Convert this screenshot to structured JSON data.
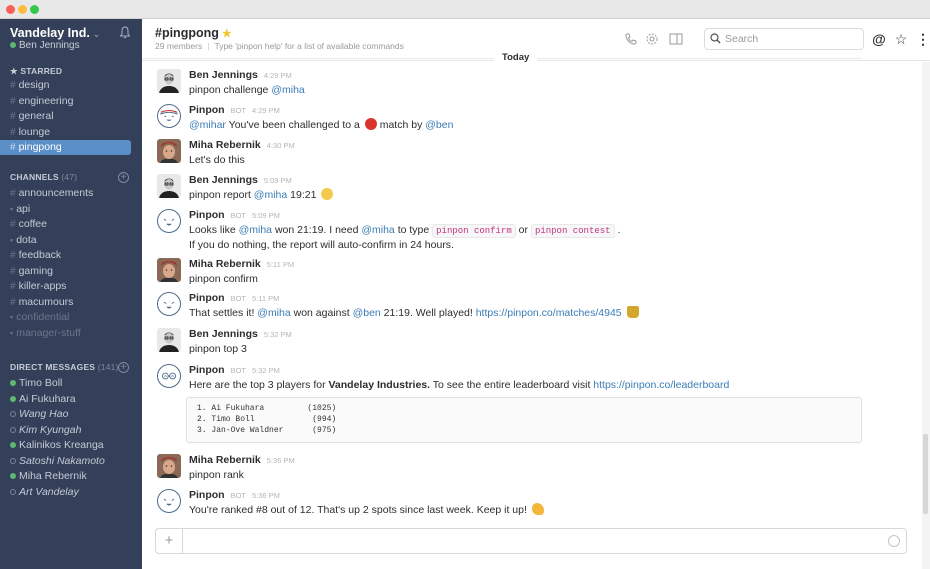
{
  "window": {
    "buttons": [
      "close",
      "minimize",
      "maximize"
    ]
  },
  "sidebar": {
    "team_name": "Vandelay Ind.",
    "current_user": "Ben Jennings",
    "starred_label": "STARRED",
    "starred": [
      {
        "name": "design",
        "prefix": "#"
      },
      {
        "name": "engineering",
        "prefix": "#"
      },
      {
        "name": "general",
        "prefix": "#"
      },
      {
        "name": "lounge",
        "prefix": "#"
      },
      {
        "name": "pingpong",
        "prefix": "#",
        "active": true
      }
    ],
    "channels_label": "CHANNELS",
    "channels_count": "(47)",
    "channels": [
      {
        "name": "announcements",
        "prefix": "#"
      },
      {
        "name": "api",
        "prefix": "lock"
      },
      {
        "name": "coffee",
        "prefix": "#"
      },
      {
        "name": "dota",
        "prefix": "lock"
      },
      {
        "name": "feedback",
        "prefix": "#"
      },
      {
        "name": "gaming",
        "prefix": "#"
      },
      {
        "name": "killer-apps",
        "prefix": "#"
      },
      {
        "name": "macumours",
        "prefix": "#"
      },
      {
        "name": "confidential",
        "prefix": "lock",
        "muted": true
      },
      {
        "name": "manager-stuff",
        "prefix": "lock",
        "muted": true
      }
    ],
    "dm_label": "DIRECT MESSAGES",
    "dm_count": "(141)",
    "dms": [
      {
        "name": "Timo Boll",
        "online": true
      },
      {
        "name": "Ai Fukuhara",
        "online": true
      },
      {
        "name": "Wang Hao",
        "online": false
      },
      {
        "name": "Kim Kyungah",
        "online": false
      },
      {
        "name": "Kalinikos Kreanga",
        "online": true
      },
      {
        "name": "Satoshi Nakamoto",
        "online": false
      },
      {
        "name": "Miha Rebernik",
        "online": true
      },
      {
        "name": "Art Vandelay",
        "online": false
      }
    ]
  },
  "header": {
    "channel": "#pingpong",
    "members": "29 members",
    "topic": "Type 'pinpon help' for a list of available commands",
    "search_placeholder": "Search",
    "icons": [
      "phone-icon",
      "gear-icon",
      "sidebar-toggle-icon",
      "mention-icon",
      "star-icon",
      "more-icon"
    ]
  },
  "divider_label": "Today",
  "messages": [
    {
      "author": "Ben Jennings",
      "time": "4:29 PM",
      "bot": false,
      "avatar": "ben",
      "parts": [
        {
          "t": "pinpon challenge "
        },
        {
          "m": "@miha"
        }
      ]
    },
    {
      "author": "Pinpon",
      "time": "4:29 PM",
      "bot": true,
      "avatar": "bot-headband",
      "parts": [
        {
          "m": "@mihar"
        },
        {
          "t": " You've been challenged to a "
        },
        {
          "e": "ping-pong-paddle"
        },
        {
          "t": " match by "
        },
        {
          "m": "@ben"
        }
      ]
    },
    {
      "author": "Miha Rebernik",
      "time": "4:30 PM",
      "bot": false,
      "avatar": "miha",
      "parts": [
        {
          "t": "Let's do this"
        }
      ]
    },
    {
      "author": "Ben Jennings",
      "time": "5:09 PM",
      "bot": false,
      "avatar": "ben",
      "parts": [
        {
          "t": "pinpon report "
        },
        {
          "m": "@miha"
        },
        {
          "t": " 19:21 "
        },
        {
          "e": "sweat-face"
        }
      ]
    },
    {
      "author": "Pinpon",
      "time": "5:09 PM",
      "bot": true,
      "avatar": "bot-happy",
      "parts": [
        {
          "t": "Looks like "
        },
        {
          "m": "@miha"
        },
        {
          "t": " won 21:19. I need "
        },
        {
          "m": "@miha"
        },
        {
          "t": " to type "
        },
        {
          "c": "pinpon confirm"
        },
        {
          "t": " or "
        },
        {
          "c": "pinpon contest"
        },
        {
          "t": " ."
        }
      ],
      "line2": "If you do nothing, the report will auto-confirm in 24 hours."
    },
    {
      "author": "Miha Rebernik",
      "time": "5:11 PM",
      "bot": false,
      "avatar": "miha",
      "parts": [
        {
          "t": "pinpon confirm"
        }
      ]
    },
    {
      "author": "Pinpon",
      "time": "5:11 PM",
      "bot": true,
      "avatar": "bot-happy",
      "parts": [
        {
          "t": "That settles it! "
        },
        {
          "m": "@miha"
        },
        {
          "t": " won against "
        },
        {
          "m": "@ben"
        },
        {
          "t": " 21:19. Well played! "
        },
        {
          "l": "https://pinpon.co/matches/4945"
        },
        {
          "t": " "
        },
        {
          "e": "trophy"
        }
      ]
    },
    {
      "author": "Ben Jennings",
      "time": "5:32 PM",
      "bot": false,
      "avatar": "ben",
      "parts": [
        {
          "t": "pinpon top 3"
        }
      ]
    },
    {
      "author": "Pinpon",
      "time": "5:32 PM",
      "bot": true,
      "avatar": "bot-glasses",
      "parts": [
        {
          "t": "Here are the top 3 players for "
        },
        {
          "b": "Vandelay Industries."
        },
        {
          "t": " To see the entire leaderboard visit "
        },
        {
          "l": "https://pinpon.co/leaderboard"
        }
      ]
    },
    {
      "author": "Miha Rebernik",
      "time": "5:36 PM",
      "bot": false,
      "avatar": "miha",
      "parts": [
        {
          "t": "pinpon rank"
        }
      ]
    },
    {
      "author": "Pinpon",
      "time": "5:36 PM",
      "bot": true,
      "avatar": "bot-happy",
      "parts": [
        {
          "t": "You're ranked #8 out of 12. That's up 2 spots since last week. Keep it up! "
        },
        {
          "e": "flexed-biceps"
        }
      ]
    }
  ],
  "leaderboard": [
    {
      "rank": "1.",
      "name": "Ai Fukuhara",
      "score": "(1025)"
    },
    {
      "rank": "2.",
      "name": "Timo Boll",
      "score": "(994)"
    },
    {
      "rank": "3.",
      "name": "Jan-Ove Waldner",
      "score": "(975)"
    }
  ],
  "composer": {
    "placeholder": "",
    "value": ""
  },
  "bot_label": "BOT"
}
